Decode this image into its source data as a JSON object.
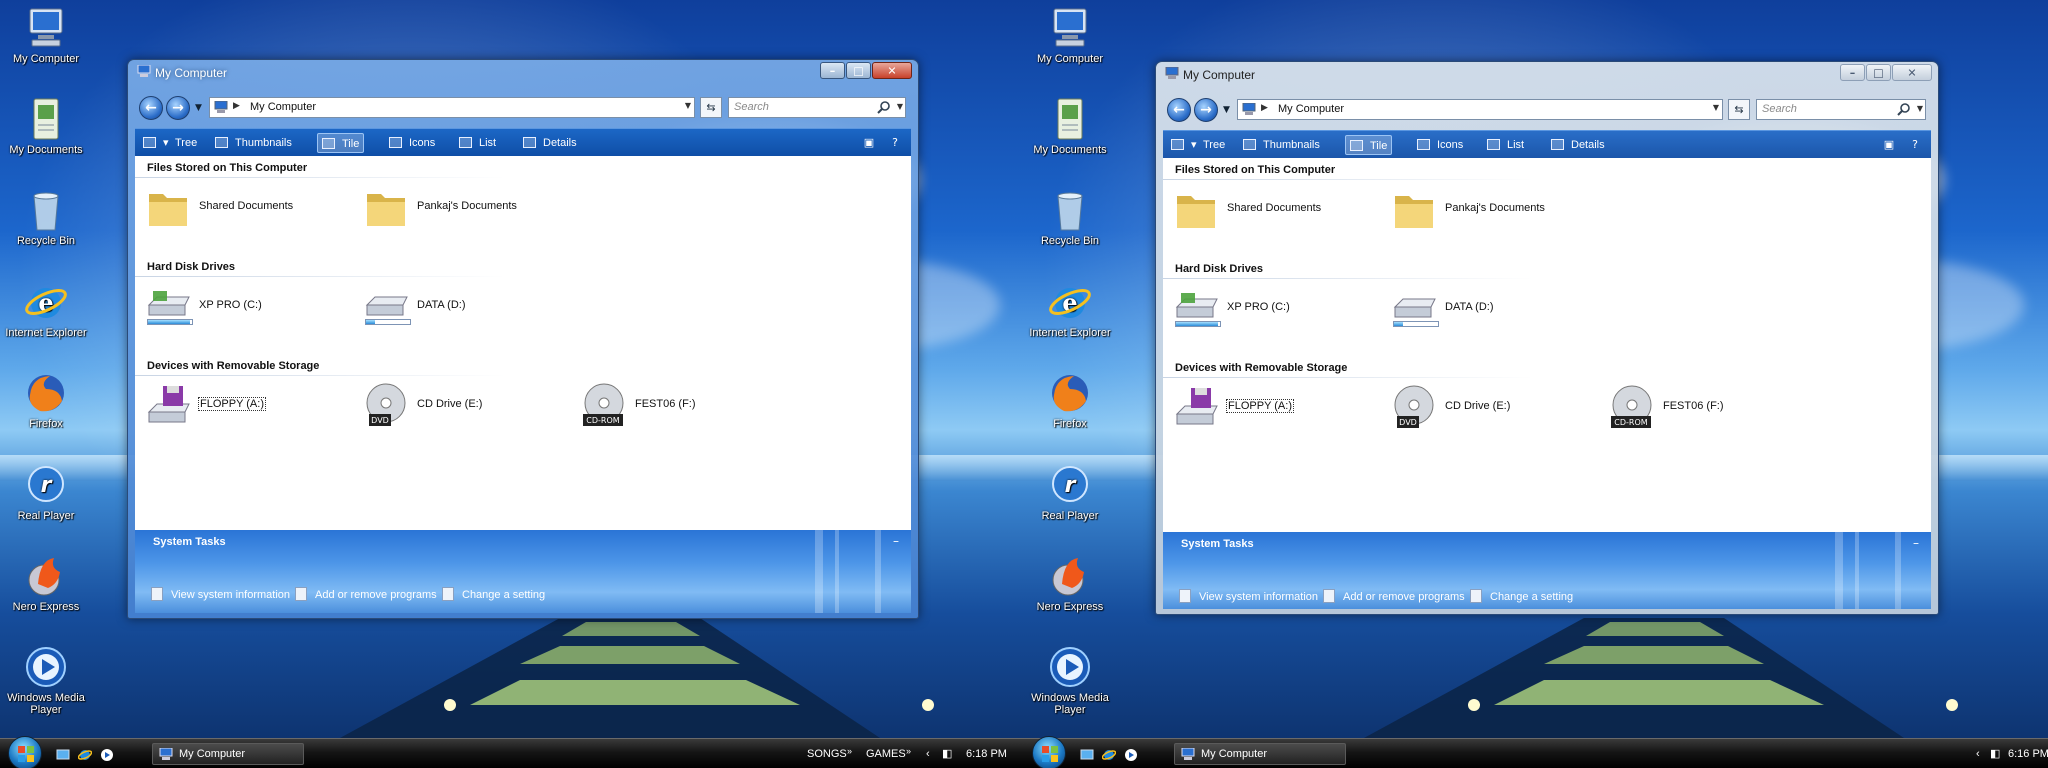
{
  "desktop_icons": [
    {
      "label": "My Computer",
      "icon": "computer-icon"
    },
    {
      "label": "My Documents",
      "icon": "documents-icon"
    },
    {
      "label": "Recycle Bin",
      "icon": "recycle-bin-icon"
    },
    {
      "label": "Internet Explorer",
      "icon": "internet-explorer-icon"
    },
    {
      "label": "Firefox",
      "icon": "firefox-icon"
    },
    {
      "label": "Real Player",
      "icon": "real-player-icon"
    },
    {
      "label": "Nero Express",
      "icon": "nero-icon"
    },
    {
      "label": "Windows Media Player",
      "icon": "media-player-icon"
    }
  ],
  "window": {
    "title": "My Computer",
    "address": "My Computer",
    "search_placeholder": "Search",
    "toolbar": {
      "tree": "Tree",
      "thumbnails": "Thumbnails",
      "tile": "Tile",
      "icons": "Icons",
      "list": "List",
      "details": "Details"
    },
    "groups": [
      {
        "name": "Files Stored on This Computer",
        "items": [
          {
            "label": "Shared Documents",
            "icon": "folder-icon"
          },
          {
            "label": "Pankaj's Documents",
            "icon": "folder-icon"
          }
        ]
      },
      {
        "name": "Hard Disk Drives",
        "items": [
          {
            "label": "XP PRO (C:)",
            "icon": "hard-drive-icon",
            "used_fraction": 0.95
          },
          {
            "label": "DATA (D:)",
            "icon": "hard-drive-icon",
            "used_fraction": 0.2
          }
        ]
      },
      {
        "name": "Devices with Removable Storage",
        "items": [
          {
            "label": "FLOPPY (A:)",
            "icon": "floppy-icon"
          },
          {
            "label": "CD Drive (E:)",
            "icon": "dvd-drive-icon",
            "badge": "DVD"
          },
          {
            "label": "FEST06 (F:)",
            "icon": "cdrom-icon",
            "badge": "CD-ROM"
          }
        ]
      }
    ],
    "system_tasks": {
      "title": "System Tasks",
      "links": [
        "View system information",
        "Add or remove programs",
        "Change a setting"
      ]
    }
  },
  "taskbar": {
    "task_label": "My Computer",
    "left_panel": {
      "toolbar_songs": "SONGS",
      "toolbar_games": "GAMES",
      "clock": "6:18 PM"
    },
    "right_panel": {
      "clock": "6:16 PM"
    }
  },
  "colors": {
    "accent": "#1c67c6",
    "taskbar": "#151515"
  }
}
